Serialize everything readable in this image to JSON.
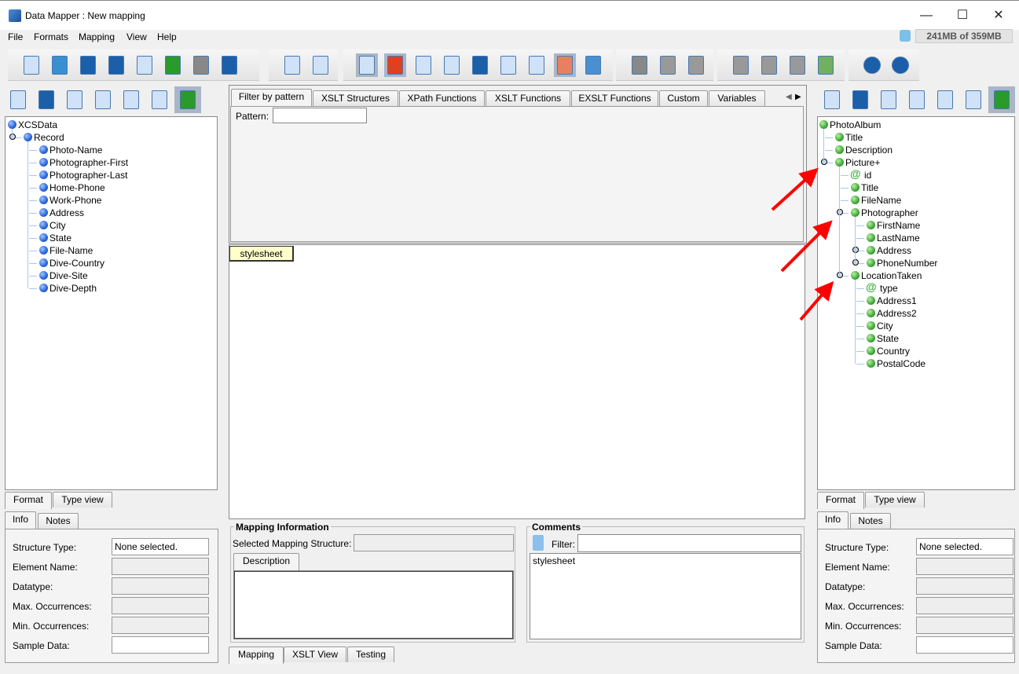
{
  "window": {
    "title": "Data Mapper : New mapping",
    "min": "—",
    "max": "☐",
    "close": "✕"
  },
  "menu": [
    "File",
    "Formats",
    "Mapping",
    "View",
    "Help"
  ],
  "memory": "241MB of 359MB",
  "toolbar": {
    "groups": [
      [
        "new-mapping",
        "open",
        "save",
        "save-as",
        "export-xls",
        "undo",
        "redo",
        "exit"
      ],
      [
        "add-structure",
        "structure-settings"
      ],
      [
        "show-info",
        "show-colors",
        "validate",
        "xslt-source",
        "save-timed",
        "view-doc",
        "xpath-view",
        "insert-text",
        "database"
      ],
      [
        "cut",
        "copy",
        "paste"
      ],
      [
        "move-up",
        "move-in",
        "move-down",
        "structure-colors"
      ],
      [
        "help",
        "about"
      ]
    ]
  },
  "left": {
    "toolbar": [
      "import-source",
      "find",
      "new-doc",
      "structure",
      "inspect",
      "edit",
      "select-mode"
    ],
    "tree": [
      {
        "label": "XCSData",
        "level": 0,
        "type": "element"
      },
      {
        "label": "Record",
        "level": 1,
        "type": "element",
        "expanded": true
      },
      {
        "label": "Photo-Name",
        "level": 2,
        "type": "element"
      },
      {
        "label": "Photographer-First",
        "level": 2,
        "type": "element"
      },
      {
        "label": "Photographer-Last",
        "level": 2,
        "type": "element"
      },
      {
        "label": "Home-Phone",
        "level": 2,
        "type": "element"
      },
      {
        "label": "Work-Phone",
        "level": 2,
        "type": "element"
      },
      {
        "label": "Address",
        "level": 2,
        "type": "element"
      },
      {
        "label": "City",
        "level": 2,
        "type": "element"
      },
      {
        "label": "State",
        "level": 2,
        "type": "element"
      },
      {
        "label": "File-Name",
        "level": 2,
        "type": "element"
      },
      {
        "label": "Dive-Country",
        "level": 2,
        "type": "element"
      },
      {
        "label": "Dive-Site",
        "level": 2,
        "type": "element"
      },
      {
        "label": "Dive-Depth",
        "level": 2,
        "type": "element"
      }
    ],
    "view_tabs": [
      "Format",
      "Type view"
    ],
    "info_tabs": [
      "Info",
      "Notes"
    ],
    "info": [
      {
        "label": "Structure Type:",
        "value": "None selected."
      },
      {
        "label": "Element Name:",
        "value": ""
      },
      {
        "label": "Datatype:",
        "value": ""
      },
      {
        "label": "Max. Occurrences:",
        "value": ""
      },
      {
        "label": "Min. Occurrences:",
        "value": ""
      },
      {
        "label": "Sample Data:",
        "value": ""
      }
    ]
  },
  "center": {
    "tabs": [
      "Filter by pattern",
      "XSLT Structures",
      "XPath Functions",
      "XSLT Functions",
      "EXSLT Functions",
      "Custom",
      "Variables"
    ],
    "pattern_label": "Pattern:",
    "pattern_value": "",
    "canvas_node": "stylesheet",
    "mapping_info": {
      "title": "Mapping Information",
      "selected_label": "Selected Mapping Structure:",
      "selected_value": "",
      "desc_tab": "Description"
    },
    "comments": {
      "title": "Comments",
      "filter_label": "Filter:",
      "filter_value": "",
      "items": [
        "stylesheet"
      ]
    },
    "bottom_tabs": [
      "Mapping",
      "XSLT View",
      "Testing"
    ]
  },
  "right": {
    "toolbar": [
      "import-target",
      "find",
      "new-doc",
      "structure",
      "inspect",
      "edit",
      "select-mode"
    ],
    "tree": [
      {
        "label": "PhotoAlbum",
        "level": 0,
        "type": "element"
      },
      {
        "label": "Title",
        "level": 1,
        "type": "element"
      },
      {
        "label": "Description",
        "level": 1,
        "type": "element"
      },
      {
        "label": "Picture+",
        "level": 1,
        "type": "element",
        "expanded": true
      },
      {
        "label": "id",
        "level": 2,
        "type": "attribute"
      },
      {
        "label": "Title",
        "level": 2,
        "type": "element"
      },
      {
        "label": "FileName",
        "level": 2,
        "type": "element"
      },
      {
        "label": "Photographer",
        "level": 2,
        "type": "element",
        "expanded": true
      },
      {
        "label": "FirstName",
        "level": 3,
        "type": "element"
      },
      {
        "label": "LastName",
        "level": 3,
        "type": "element"
      },
      {
        "label": "Address",
        "level": 3,
        "type": "element",
        "collapsed": true
      },
      {
        "label": "PhoneNumber",
        "level": 3,
        "type": "element",
        "collapsed": true
      },
      {
        "label": "LocationTaken",
        "level": 2,
        "type": "element",
        "expanded": true
      },
      {
        "label": "type",
        "level": 3,
        "type": "attribute"
      },
      {
        "label": "Address1",
        "level": 3,
        "type": "element"
      },
      {
        "label": "Address2",
        "level": 3,
        "type": "element"
      },
      {
        "label": "City",
        "level": 3,
        "type": "element"
      },
      {
        "label": "State",
        "level": 3,
        "type": "element"
      },
      {
        "label": "Country",
        "level": 3,
        "type": "element"
      },
      {
        "label": "PostalCode",
        "level": 3,
        "type": "element"
      }
    ],
    "view_tabs": [
      "Format",
      "Type view"
    ],
    "info_tabs": [
      "Info",
      "Notes"
    ],
    "info": [
      {
        "label": "Structure Type:",
        "value": "None selected."
      },
      {
        "label": "Element Name:",
        "value": ""
      },
      {
        "label": "Datatype:",
        "value": ""
      },
      {
        "label": "Max. Occurrences:",
        "value": ""
      },
      {
        "label": "Min. Occurrences:",
        "value": ""
      },
      {
        "label": "Sample Data:",
        "value": ""
      }
    ]
  },
  "colors": {
    "annotation_arrow": "#ff0000",
    "node_fill": "#ffffcc",
    "selected_tool": "#a9b6c7"
  }
}
